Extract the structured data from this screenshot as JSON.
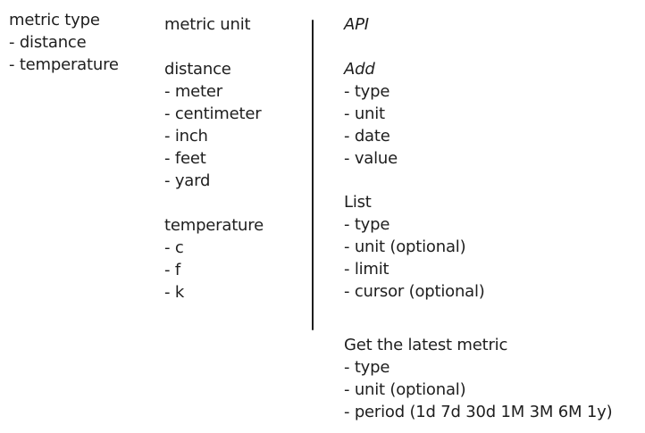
{
  "metric_type": {
    "title": "metric type",
    "items": [
      "- distance",
      "- temperature"
    ]
  },
  "metric_unit": {
    "title": "metric unit",
    "distance": {
      "title": "distance",
      "items": [
        "- meter",
        "- centimeter",
        "- inch",
        "- feet",
        "- yard"
      ]
    },
    "temperature": {
      "title": "temperature",
      "items": [
        "- c",
        "- f",
        "- k"
      ]
    }
  },
  "api": {
    "title": "API",
    "add": {
      "title": "Add",
      "items": [
        "- type",
        "- unit",
        "- date",
        "- value"
      ]
    },
    "list": {
      "title": "List",
      "items": [
        "- type",
        "- unit (optional)",
        "- limit",
        "- cursor (optional)"
      ]
    },
    "latest": {
      "title": "Get the latest metric",
      "items": [
        "- type",
        "- unit (optional)",
        "- period (1d 7d 30d 1M 3M 6M 1y)"
      ]
    }
  }
}
